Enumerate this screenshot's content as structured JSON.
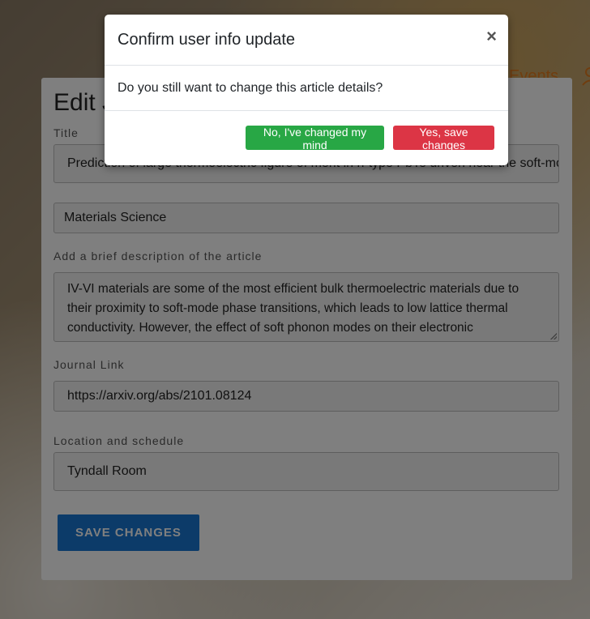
{
  "nav": {
    "events_label": "Events"
  },
  "form": {
    "title": "Edit J",
    "title_label": "Title",
    "title_value": "Prediction of large thermoelectric figure of merit in n-type PbTe driven near the soft-mode transition",
    "subject_value": "Materials Science",
    "description_label": "Add a brief description of the article",
    "description_value": "IV-VI materials are some of the most efficient bulk thermoelectric materials due to their proximity to soft-mode phase transitions, which leads to low lattice thermal conductivity. However, the effect of soft phonon modes on their electronic",
    "link_label": "Journal Link",
    "link_value": "https://arxiv.org/abs/2101.08124",
    "location_label": "Location and schedule",
    "location_value": "Tyndall Room",
    "save_label": "SAVE CHANGES"
  },
  "modal": {
    "title": "Confirm user info update",
    "close_glyph": "×",
    "body": "Do you still want to change this article details?",
    "cancel_label": "No, I've changed my mind",
    "confirm_label": "Yes, save changes"
  },
  "colors": {
    "accent_orange": "#e07b1f",
    "save_blue": "#1976d2",
    "no_green": "#28a745",
    "yes_red": "#dc3545"
  }
}
